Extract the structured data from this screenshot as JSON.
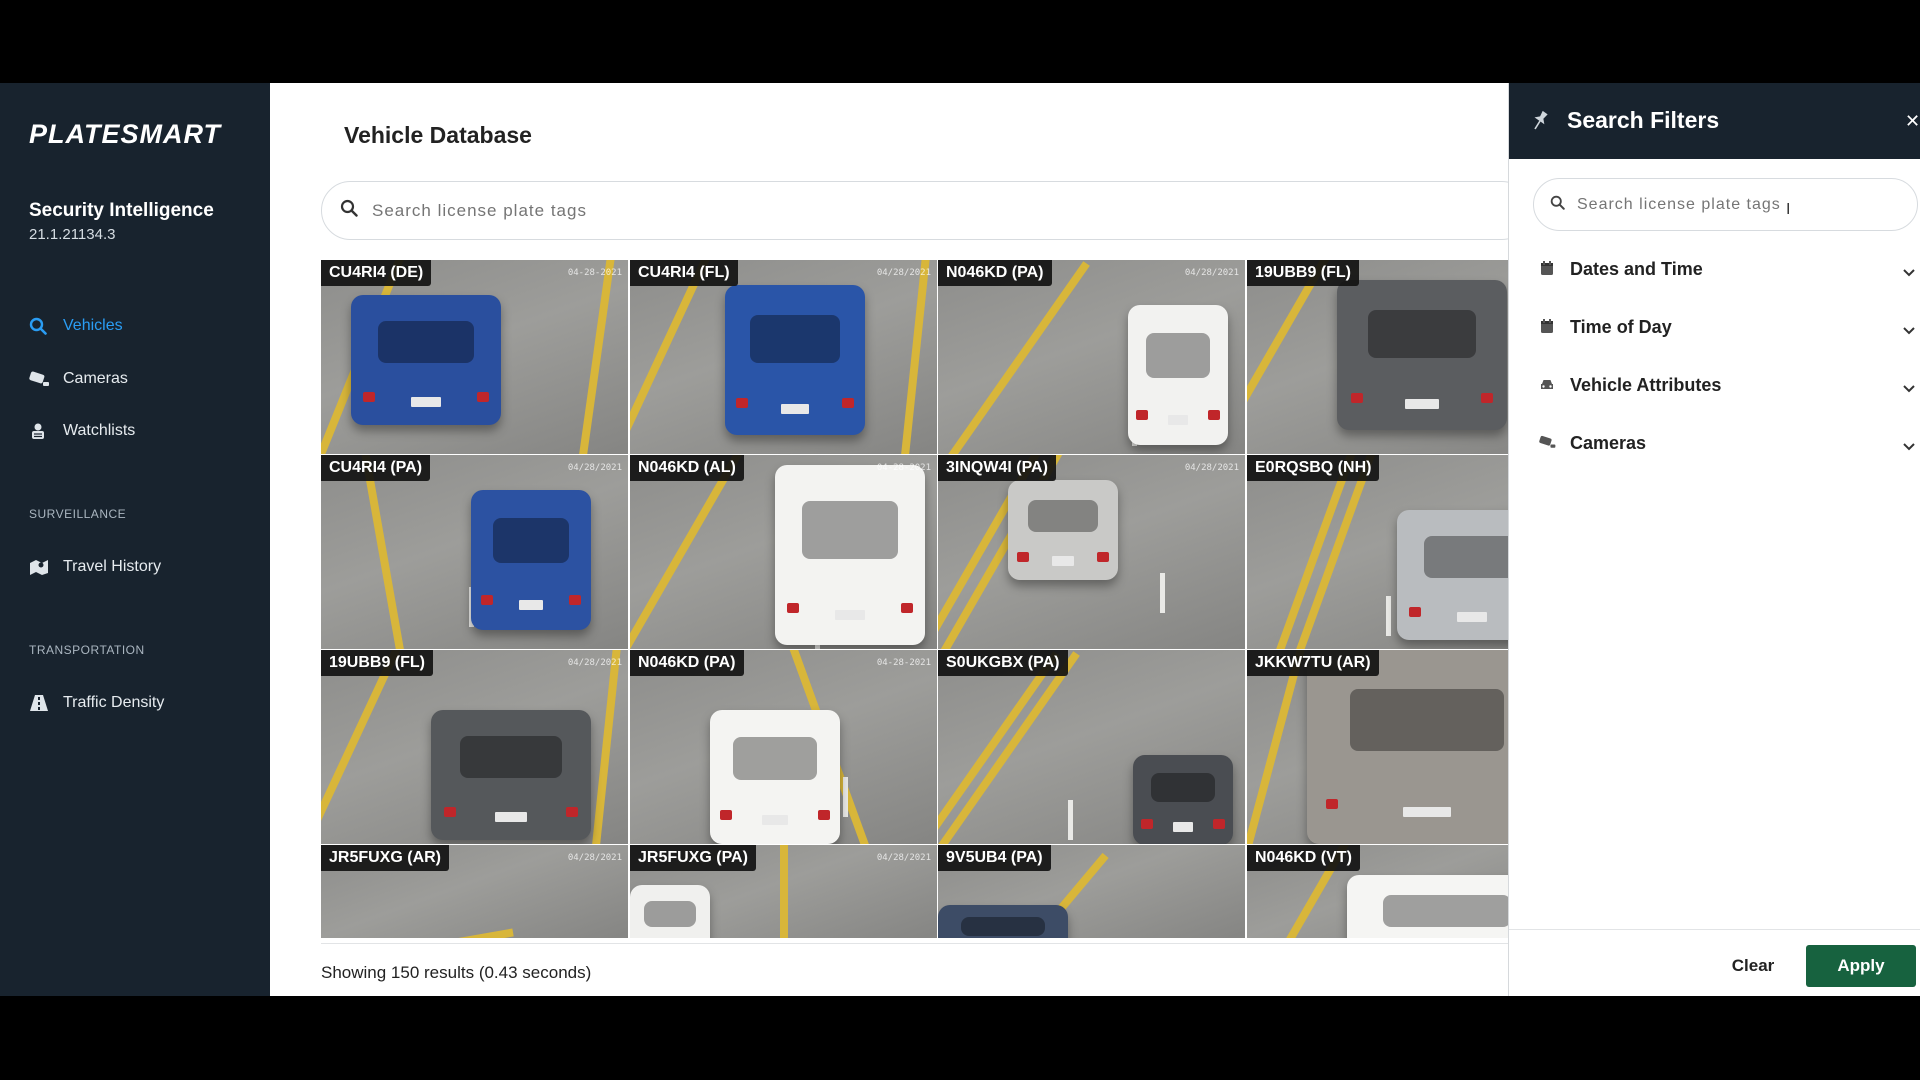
{
  "app": {
    "logo_text": "PLATESMART",
    "product_name": "Security Intelligence",
    "version": "21.1.21134.3"
  },
  "sidebar": {
    "items": [
      {
        "label": "Vehicles",
        "icon": "search-icon",
        "active": true
      },
      {
        "label": "Cameras",
        "icon": "camera-icon",
        "active": false
      },
      {
        "label": "Watchlists",
        "icon": "watchlist-icon",
        "active": false
      }
    ],
    "sections": [
      {
        "label": "SURVEILLANCE",
        "items": [
          {
            "label": "Travel History",
            "icon": "map-icon"
          }
        ]
      },
      {
        "label": "TRANSPORTATION",
        "items": [
          {
            "label": "Traffic Density",
            "icon": "road-icon"
          }
        ]
      }
    ]
  },
  "main": {
    "title": "Vehicle Database",
    "search_placeholder": "Search license plate tags",
    "results_text": "Showing 150 results (0.43 seconds)"
  },
  "tiles": [
    {
      "label": "CU4RI4 (DE)",
      "stamp": "04-28-2021",
      "vehicle_color": "#2a4f9e"
    },
    {
      "label": "CU4RI4 (FL)",
      "stamp": "04/28/2021",
      "vehicle_color": "#2a55a8"
    },
    {
      "label": "N046KD (PA)",
      "stamp": "04/28/2021",
      "vehicle_color": "#f2f2f0"
    },
    {
      "label": "19UBB9 (FL)",
      "stamp": "04/2",
      "vehicle_color": "#5b5d60"
    },
    {
      "label": "CU4RI4 (PA)",
      "stamp": "04/28/2021",
      "vehicle_color": "#2c52a2"
    },
    {
      "label": "N046KD (AL)",
      "stamp": "04-28-2021",
      "vehicle_color": "#f3f3f1"
    },
    {
      "label": "3INQW4I (PA)",
      "stamp": "04/28/2021",
      "vehicle_color": "#c9c9c7"
    },
    {
      "label": "E0RQSBQ (NH)",
      "stamp": "04/2",
      "vehicle_color": "#b9bcbf"
    },
    {
      "label": "19UBB9 (FL)",
      "stamp": "04/28/2021",
      "vehicle_color": "#55585b"
    },
    {
      "label": "N046KD (PA)",
      "stamp": "04-28-2021",
      "vehicle_color": "#f4f4f2"
    },
    {
      "label": "S0UKGBX (PA)",
      "stamp": "",
      "vehicle_color": "#4a4d52"
    },
    {
      "label": "JKKW7TU (AR)",
      "stamp": "04/",
      "vehicle_color": "#9a9690"
    },
    {
      "label": "JR5FUXG (AR)",
      "stamp": "04/28/2021",
      "vehicle_color": "#a3a3a0"
    },
    {
      "label": "JR5FUXG (PA)",
      "stamp": "04/28/2021",
      "vehicle_color": "#f0f0ee"
    },
    {
      "label": "9V5UB4 (PA)",
      "stamp": "",
      "vehicle_color": "#3d4c66"
    },
    {
      "label": "N046KD (VT)",
      "stamp": "228",
      "vehicle_color": "#f5f5f3"
    }
  ],
  "filters": {
    "title": "Search Filters",
    "search_placeholder": "Search license plate tags",
    "groups": [
      {
        "label": "Dates and Time",
        "icon": "calendar-icon"
      },
      {
        "label": "Time of Day",
        "icon": "calendar-icon"
      },
      {
        "label": "Vehicle Attributes",
        "icon": "car-icon"
      },
      {
        "label": "Cameras",
        "icon": "camera-icon"
      }
    ],
    "clear_label": "Clear",
    "apply_label": "Apply"
  },
  "colors": {
    "sidebar_bg": "#18232e",
    "accent": "#2a9df4",
    "apply_green": "#17623f"
  }
}
